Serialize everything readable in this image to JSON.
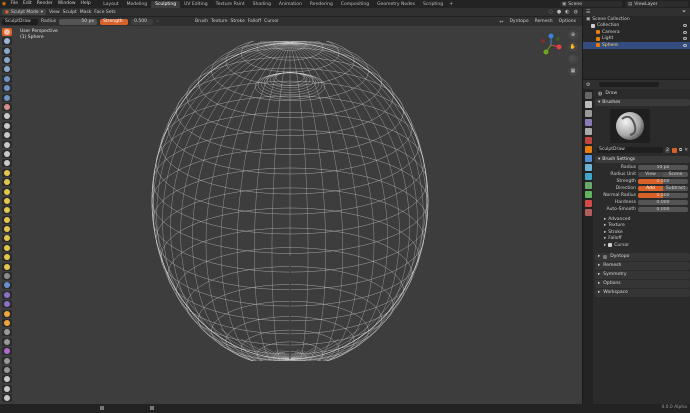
{
  "menubar": {
    "items": [
      "File",
      "Edit",
      "Render",
      "Window",
      "Help"
    ],
    "workspaces": [
      "Layout",
      "Modeling",
      "Sculpting",
      "UV Editing",
      "Texture Paint",
      "Shading",
      "Animation",
      "Rendering",
      "Compositing",
      "Geometry Nodes",
      "Scripting"
    ],
    "active_workspace": "Sculpting",
    "scene": "Scene",
    "view_layer": "ViewLayer"
  },
  "header": {
    "mode": "Sculpt Mode",
    "menus": [
      "View",
      "Sculpt",
      "Mask",
      "Face Sets"
    ]
  },
  "tool_header": {
    "brush": "SculptDraw",
    "radius_label": "Radius",
    "radius_value": "50 px",
    "strength_label": "Strength",
    "strength_value": "0.500",
    "dropdowns": [
      "Brush",
      "Texture",
      "Stroke",
      "Falloff",
      "Cursor"
    ],
    "right_items": [
      "Dyntopo",
      "Remesh",
      "Options"
    ]
  },
  "viewport": {
    "view_name": "User Perspective",
    "object_name": "(1) Sphere",
    "gizmo_axes": {
      "x": "#e0423f",
      "y": "#6ea51b",
      "z": "#3b80d6"
    }
  },
  "toolbar": {
    "tools": [
      "draw",
      "draw-sharp",
      "clay",
      "clay-strips",
      "clay-thumb",
      "layer",
      "inflate",
      "blob",
      "crease",
      "smooth",
      "flatten",
      "fill",
      "scrape",
      "multiplane-scrape",
      "pinch",
      "grab",
      "elastic-deform",
      "snake-hook",
      "thumb",
      "pose",
      "nudge",
      "rotate",
      "slide-relax",
      "boundary",
      "cloth",
      "simplify",
      "mask",
      "draw-face-sets",
      "multires-displacement-eraser",
      "multires-displacement-smear",
      "paint",
      "smear",
      "box-mask",
      "box-hide",
      "box-face-set",
      "box-trim",
      "line-project",
      "mesh-filter",
      "cloth-filter",
      "color-filter",
      "edit-face-set",
      "mask-by-color",
      "move",
      "rotate-transform",
      "scale",
      "transform",
      "annotate"
    ],
    "active_index": 0
  },
  "outliner": {
    "title": "Scene Collection",
    "rows": [
      {
        "label": "Collection",
        "indent": 1,
        "icon": "#cfcfcf"
      },
      {
        "label": "Camera",
        "indent": 2,
        "icon": "#e87d0d"
      },
      {
        "label": "Light",
        "indent": 2,
        "icon": "#e87d0d"
      },
      {
        "label": "Sphere",
        "indent": 2,
        "icon": "#e87d0d",
        "selected": true
      }
    ]
  },
  "properties": {
    "tool_name": "Draw",
    "brushes_label": "Brushes",
    "brush_name": "SculptDraw",
    "brush_users": "2",
    "brush_settings_label": "Brush Settings",
    "radius_label": "Radius",
    "radius_value": "50 px",
    "radius_unit_label": "Radius Unit",
    "radius_unit_options": [
      "View",
      "Scene"
    ],
    "strength_label": "Strength",
    "strength_value": "0.500",
    "strength_fraction": 0.5,
    "direction_label": "Direction",
    "direction_options": [
      "Add",
      "Subtract"
    ],
    "normal_radius_label": "Normal Radius",
    "normal_radius_value": "0.500",
    "normal_radius_fraction": 0.5,
    "hardness_label": "Hardness",
    "hardness_value": "0.000",
    "autosmooth_label": "Auto-Smooth",
    "autosmooth_value": "0.000",
    "subpanels": [
      "Advanced",
      "Texture",
      "Stroke",
      "Falloff",
      "Cursor"
    ],
    "cursor_checked": true,
    "panels": [
      "Dyntopo",
      "Remesh",
      "Symmetry",
      "Options",
      "Workspace"
    ]
  },
  "statusbar": {
    "version": "4.0.0 Alpha"
  }
}
